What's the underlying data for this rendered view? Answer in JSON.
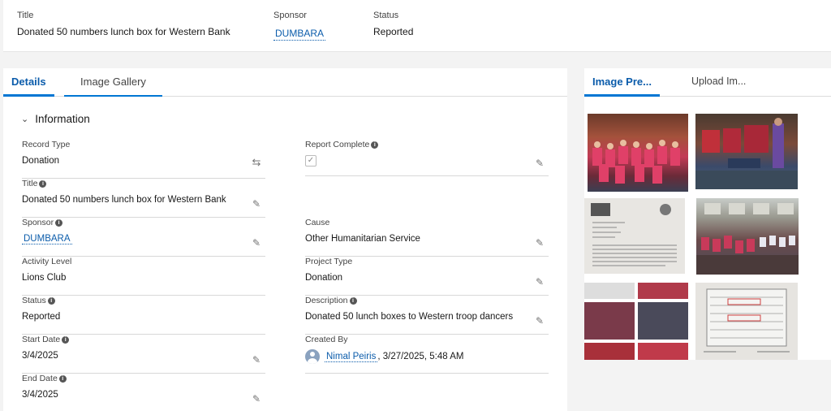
{
  "highlights": {
    "title_label": "Title",
    "title_value": "Donated 50 numbers lunch box for Western Bank",
    "sponsor_label": "Sponsor",
    "sponsor_value": "DUMBARA",
    "status_label": "Status",
    "status_value": "Reported"
  },
  "tabs": {
    "details": "Details",
    "image_gallery": "Image Gallery"
  },
  "section": {
    "title": "Information"
  },
  "fields": {
    "record_type": {
      "label": "Record Type",
      "value": "Donation"
    },
    "report_complete": {
      "label": "Report Complete",
      "checked": true
    },
    "title": {
      "label": "Title",
      "value": "Donated 50 numbers lunch box for Western Bank"
    },
    "sponsor": {
      "label": "Sponsor",
      "value": "DUMBARA"
    },
    "cause": {
      "label": "Cause",
      "value": "Other Humanitarian Service"
    },
    "activity_level": {
      "label": "Activity Level",
      "value": "Lions Club"
    },
    "project_type": {
      "label": "Project Type",
      "value": "Donation"
    },
    "status": {
      "label": "Status",
      "value": "Reported"
    },
    "description": {
      "label": "Description",
      "value": "Donated 50 lunch boxes to Western troop dancers"
    },
    "start_date": {
      "label": "Start Date",
      "value": "3/4/2025"
    },
    "created_by": {
      "label": "Created By",
      "user": "Nimal Peiris",
      "timestamp": ", 3/27/2025, 5:48 AM"
    },
    "end_date": {
      "label": "End Date",
      "value": "3/4/2025"
    }
  },
  "right_tabs": {
    "image_preview": "Image Pre...",
    "upload_images": "Upload Im..."
  },
  "colors": {
    "accent": "#0176d3",
    "link": "#0b5cab"
  }
}
